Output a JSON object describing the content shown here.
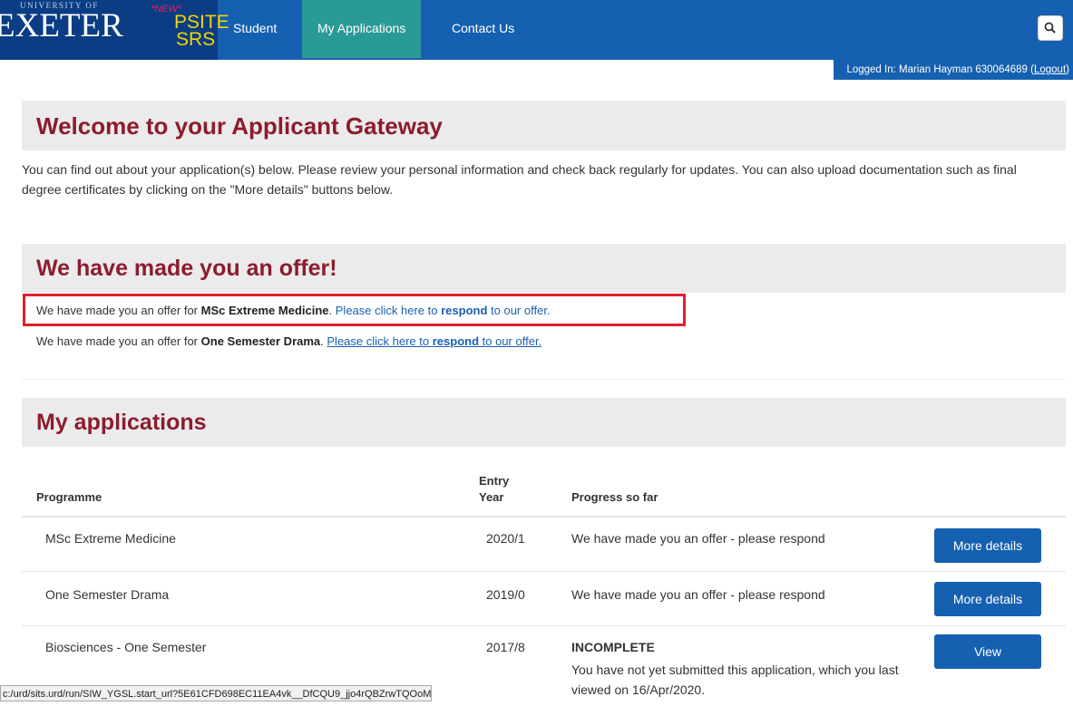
{
  "header": {
    "logo_small": "UNIVERSITY OF",
    "logo_big": "EXETER",
    "psite_new": "*NEW*",
    "psite_line1": "PSITE",
    "psite_line2": "SRS",
    "nav": [
      "Student",
      "My Applications",
      "Contact Us"
    ],
    "active_nav": "My Applications",
    "search_icon": "search-icon",
    "login_prefix": "Logged In: Marian Hayman 630064689 (",
    "logout": "Logout",
    "login_suffix": ")"
  },
  "welcome": {
    "title": "Welcome to your Applicant Gateway",
    "text": "You can find out about your application(s) below. Please review your personal information and check back regularly for updates. You can also upload documentation such as final degree certificates by clicking on the \"More details\" buttons below."
  },
  "offer": {
    "title": "We have made you an offer!",
    "items": [
      {
        "prefix": "We have made you an offer for ",
        "programme": "MSc Extreme Medicine",
        "link_pre": "Please click here to ",
        "link_bold": "respond",
        "link_post": " to our offer."
      },
      {
        "prefix": "We have made you an offer for ",
        "programme": "One Semester Drama",
        "link_pre": "Please click here to ",
        "link_bold": "respond",
        "link_post": " to our offer."
      }
    ]
  },
  "applications": {
    "title": "My applications",
    "headers": {
      "programme": "Programme",
      "entry_1": "Entry",
      "entry_2": "Year",
      "progress": "Progress so far"
    },
    "rows": [
      {
        "programme": "MSc Extreme Medicine",
        "year": "2020/1",
        "progress": "We have made you an offer - please respond",
        "button": "More details"
      },
      {
        "programme": "One Semester Drama",
        "year": "2019/0",
        "progress": "We have made you an offer - please respond",
        "button": "More details"
      },
      {
        "programme": "Biosciences - One Semester",
        "year": "2017/8",
        "status": "INCOMPLETE",
        "progress": "You have not yet submitted this application, which you last viewed on 16/Apr/2020.",
        "button": "View"
      }
    ]
  },
  "status_bar_url": "c:/urd/sits.urd/run/SIW_YGSL.start_url?5E61CFD698EC11EA4vk__DfCQU9_jjo4rQBZrwTQOoMRxJ5...",
  "colors": {
    "nav": "#1560b0",
    "active": "#2a9a97",
    "heading": "#8c1c2e",
    "highlight": "#e0202e"
  }
}
